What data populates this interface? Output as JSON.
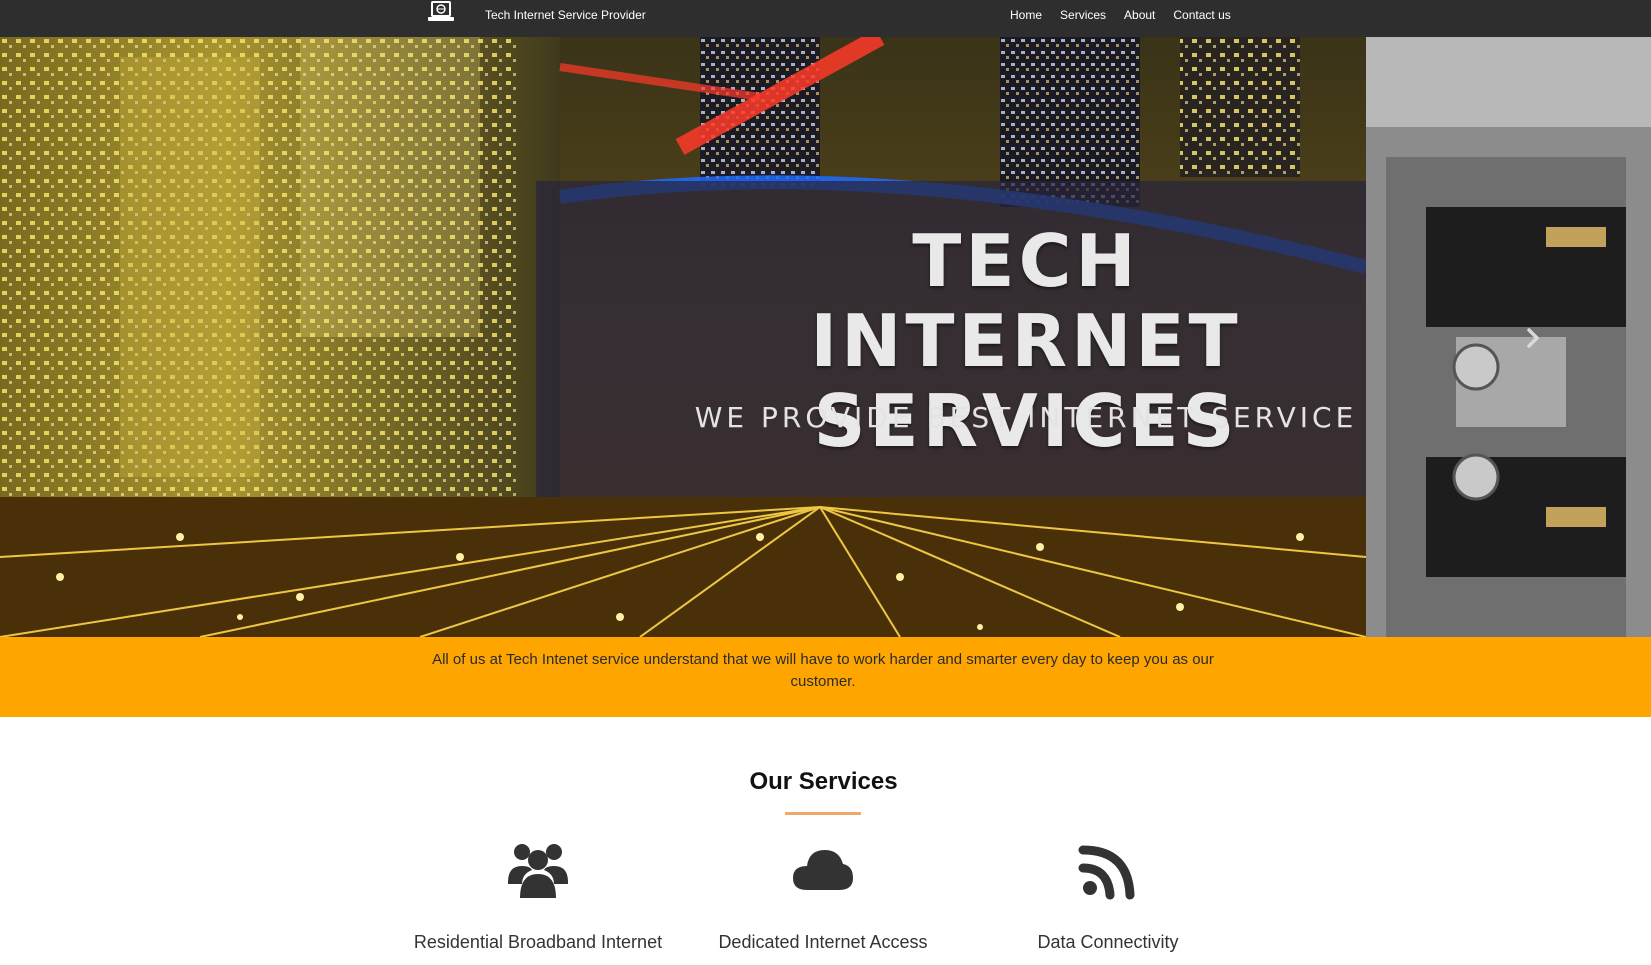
{
  "navbar": {
    "brand_name": "Tech Internet Service Provider",
    "brand_icon": "laptop-globe-icon",
    "links": [
      "Home",
      "Services",
      "About",
      "Contact us"
    ]
  },
  "hero": {
    "title_line1": "TECH INTERNET",
    "title_line2": "SERVICES",
    "subtitle": "WE PROVIDE BEST INTERNET SERVICE",
    "next_icon": "chevron-right-icon"
  },
  "banner": {
    "text": "All of us at Tech Intenet service understand that we will have to work harder and smarter every day to keep you as our customer.",
    "color": "#ffa500"
  },
  "services": {
    "heading": "Our Services",
    "underline_color": "#f0a86a",
    "items": [
      {
        "title": "Residential Broadband Internet",
        "icon": "users-icon"
      },
      {
        "title": "Dedicated Internet Access",
        "icon": "cloud-icon"
      },
      {
        "title": "Data Connectivity",
        "icon": "rss-icon"
      }
    ]
  }
}
